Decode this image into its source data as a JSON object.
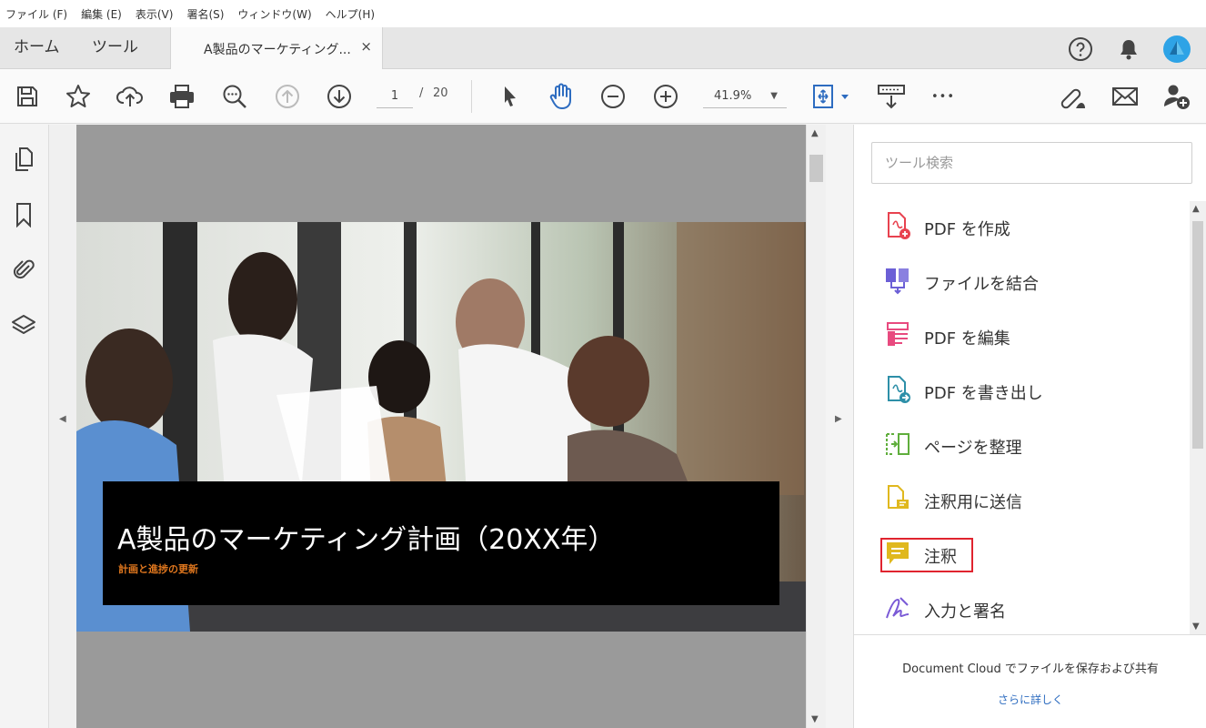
{
  "menu": [
    "ファイル (F)",
    "編集 (E)",
    "表示(V)",
    "署名(S)",
    "ウィンドウ(W)",
    "ヘルプ(H)"
  ],
  "tabs": {
    "home": "ホーム",
    "tools": "ツール",
    "document_title": "A製品のマーケティング...",
    "close": "×"
  },
  "toolbar": {
    "current_page": "1",
    "page_separator": "/",
    "total_pages": "20",
    "zoom": "41.9%",
    "more": "•••"
  },
  "document": {
    "title": "A製品のマーケティング計画（20XX年）",
    "subtitle": "計画と進捗の更新"
  },
  "tools_pane": {
    "search_placeholder": "ツール検索",
    "items": [
      {
        "label": "PDF を作成",
        "icon": "create-pdf-icon",
        "color": "#e8424f"
      },
      {
        "label": "ファイルを結合",
        "icon": "combine-files-icon",
        "color": "#6b5fd6"
      },
      {
        "label": "PDF を編集",
        "icon": "edit-pdf-icon",
        "color": "#e84a7f"
      },
      {
        "label": "PDF を書き出し",
        "icon": "export-pdf-icon",
        "color": "#2d8fa8"
      },
      {
        "label": "ページを整理",
        "icon": "organize-pages-icon",
        "color": "#5fae3c"
      },
      {
        "label": "注釈用に送信",
        "icon": "send-for-comments-icon",
        "color": "#e0b81e"
      },
      {
        "label": "注釈",
        "icon": "comment-icon",
        "color": "#e0b81e"
      },
      {
        "label": "入力と署名",
        "icon": "fill-sign-icon",
        "color": "#7a5ad6"
      }
    ],
    "cloud_text": "Document Cloud でファイルを保存および共有",
    "learn_more": "さらに詳しく"
  },
  "colors": {
    "highlight": "#e0242f",
    "accent_blue": "#2d6cc0",
    "subtitle_orange": "#e0771e",
    "avatar_blue": "#2ea3e6"
  }
}
